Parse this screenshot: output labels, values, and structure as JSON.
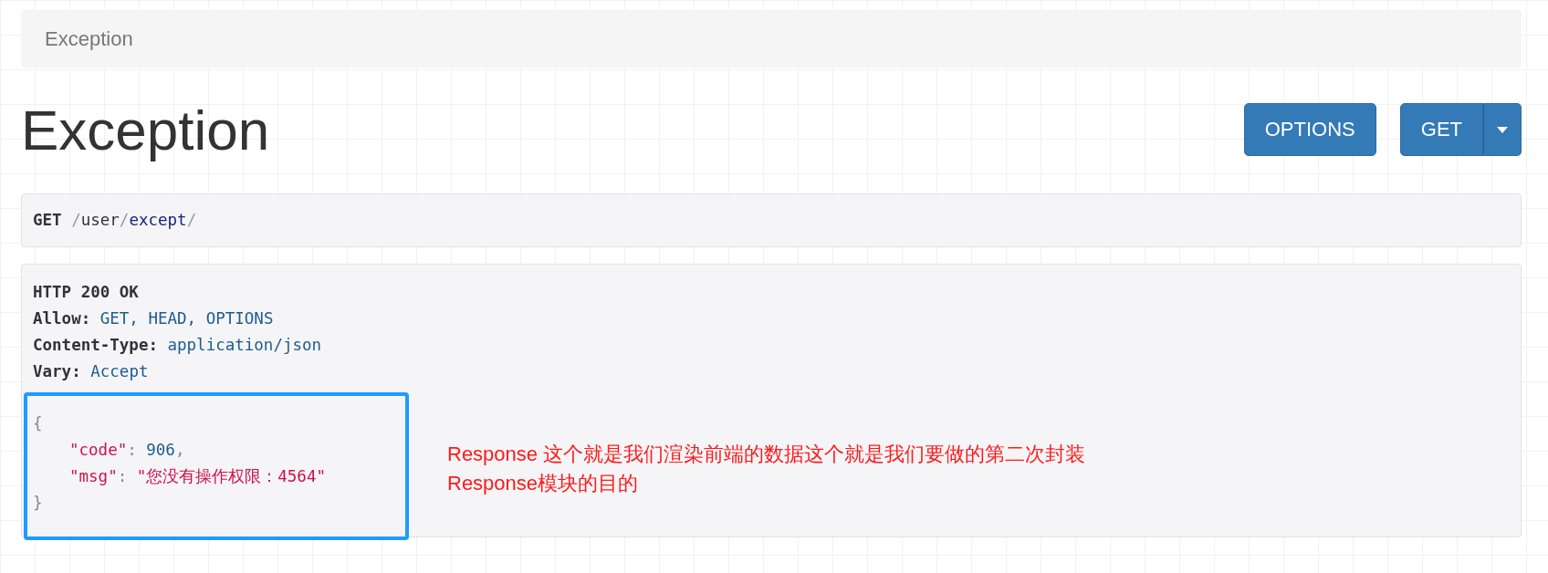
{
  "breadcrumb": {
    "label": "Exception"
  },
  "title": "Exception",
  "buttons": [
    {
      "label": "OPTIONS",
      "kind": "plain"
    },
    {
      "label": "GET",
      "kind": "split"
    }
  ],
  "request": {
    "method": "GET",
    "path": [
      {
        "text": "/",
        "kind": "sep"
      },
      {
        "text": "user",
        "kind": "plain"
      },
      {
        "text": "/",
        "kind": "sep"
      },
      {
        "text": "except",
        "kind": "link"
      },
      {
        "text": "/",
        "kind": "sep"
      }
    ]
  },
  "response": {
    "status": "HTTP 200 OK",
    "headers": [
      {
        "name": "Allow:",
        "value": "GET, HEAD, OPTIONS"
      },
      {
        "name": "Content-Type:",
        "value": "application/json"
      },
      {
        "name": "Vary:",
        "value": "Accept"
      }
    ],
    "body": [
      {
        "indented": false,
        "tokens": [
          {
            "text": "{",
            "kind": "punct"
          }
        ]
      },
      {
        "indented": true,
        "tokens": [
          {
            "text": "\"code\"",
            "kind": "key"
          },
          {
            "text": ": ",
            "kind": "punct"
          },
          {
            "text": "906",
            "kind": "number"
          },
          {
            "text": ",",
            "kind": "punct"
          }
        ]
      },
      {
        "indented": true,
        "tokens": [
          {
            "text": "\"msg\"",
            "kind": "key"
          },
          {
            "text": ": ",
            "kind": "punct"
          },
          {
            "text": "\"您没有操作权限：4564\"",
            "kind": "string"
          }
        ]
      },
      {
        "indented": false,
        "tokens": [
          {
            "text": "}",
            "kind": "punct"
          }
        ]
      }
    ]
  },
  "annotation": [
    "Response 这个就是我们渲染前端的数据这个就是我们要做的第二次封装",
    "Response模块的目的"
  ]
}
